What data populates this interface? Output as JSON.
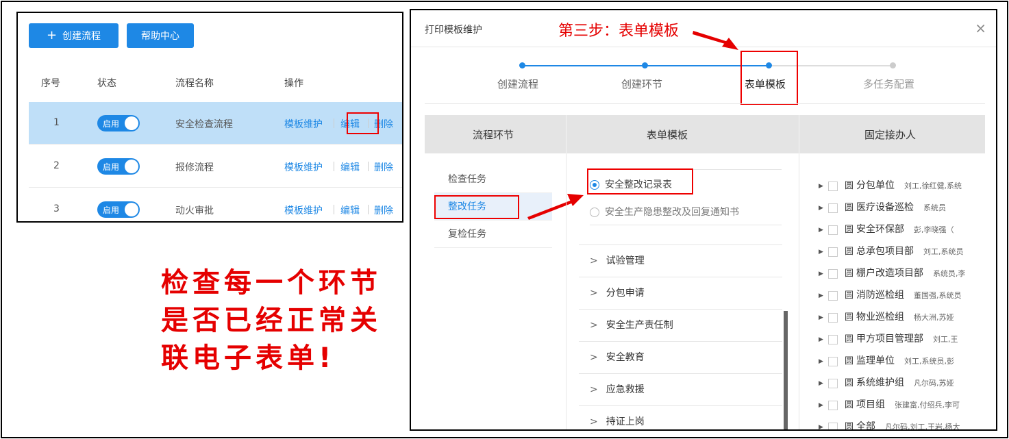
{
  "left": {
    "create_button": "创建流程",
    "help_button": "帮助中心",
    "headers": {
      "no": "序号",
      "status": "状态",
      "name": "流程名称",
      "ops": "操作"
    },
    "rows": [
      {
        "no": "1",
        "toggle": "启用",
        "name": "安全检查流程",
        "op_template": "模板维护",
        "op_edit": "编辑",
        "op_delete": "删除"
      },
      {
        "no": "2",
        "toggle": "启用",
        "name": "报修流程",
        "op_template": "模板维护",
        "op_edit": "编辑",
        "op_delete": "删除"
      },
      {
        "no": "3",
        "toggle": "启用",
        "name": "动火审批",
        "op_template": "模板维护",
        "op_edit": "编辑",
        "op_delete": "删除"
      }
    ]
  },
  "annotation": {
    "big_text": [
      "检查每一个环节",
      "是否已经正常关",
      "联电子表单!"
    ],
    "step_title": "第三步：表单模板"
  },
  "dialog": {
    "title": "打印模板维护",
    "close": "×",
    "steps": [
      "创建流程",
      "创建环节",
      "表单模板",
      "多任务配置"
    ],
    "columns": [
      "流程环节",
      "表单模板",
      "固定接办人"
    ],
    "tasks": [
      "检查任务",
      "整改任务",
      "复检任务"
    ],
    "forms": [
      "安全整改记录表",
      "安全生产隐患整改及回复通知书"
    ],
    "groups": [
      "试验管理",
      "分包申请",
      "安全生产责任制",
      "安全教育",
      "应急救援",
      "持证上岗"
    ],
    "assignees": [
      {
        "name": "分包单位",
        "users": "刘工,徐红健,系统"
      },
      {
        "name": "医疗设备巡检",
        "users": "系统员"
      },
      {
        "name": "安全环保部",
        "users": "彭,李晓强（"
      },
      {
        "name": "总承包项目部",
        "users": "刘工,系统员"
      },
      {
        "name": "棚户改造项目部",
        "users": "系统员,李"
      },
      {
        "name": "消防巡检组",
        "users": "董国强,系统员"
      },
      {
        "name": "物业巡检组",
        "users": "杨大洲,苏娅"
      },
      {
        "name": "甲方项目管理部",
        "users": "刘工,王"
      },
      {
        "name": "监理单位",
        "users": "刘工,系统员,彭"
      },
      {
        "name": "系统维护组",
        "users": "凡尔码,苏娅"
      },
      {
        "name": "项目组",
        "users": "张建富,付绍兵,李可"
      },
      {
        "name": "全部",
        "users": "凡尔码,刘工,王岩,杨大"
      }
    ]
  },
  "colors": {
    "primary": "#1e88e5",
    "annotation_red": "#e50000"
  }
}
